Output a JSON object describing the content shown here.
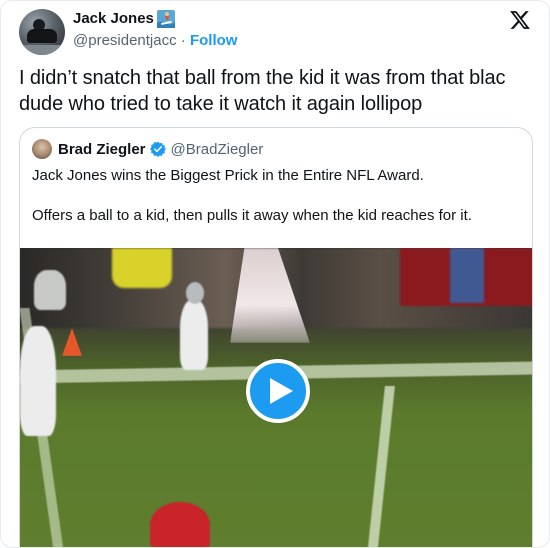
{
  "author": {
    "display_name": "Jack Jones",
    "name_emoji": "🏄",
    "handle": "@presidentjacc",
    "separator": "·",
    "follow_label": "Follow"
  },
  "tweet": {
    "text": "I didn’t snatch that ball from the kid it was from that blac dude who tried to take it watch it again lollipop"
  },
  "quoted": {
    "display_name": "Brad Ziegler",
    "handle": "@BradZiegler",
    "paragraphs": [
      "Jack Jones wins the Biggest Prick in the Entire NFL Award.",
      "Offers a ball to a kid, then pulls it away when the kid reaches for it."
    ]
  },
  "colors": {
    "accent": "#1d9bf0",
    "text": "#0f1419",
    "muted": "#536471",
    "border": "#cfd9de"
  },
  "icons": {
    "brand": "x-logo-icon",
    "verified": "verified-badge-icon",
    "video": "play-icon"
  }
}
